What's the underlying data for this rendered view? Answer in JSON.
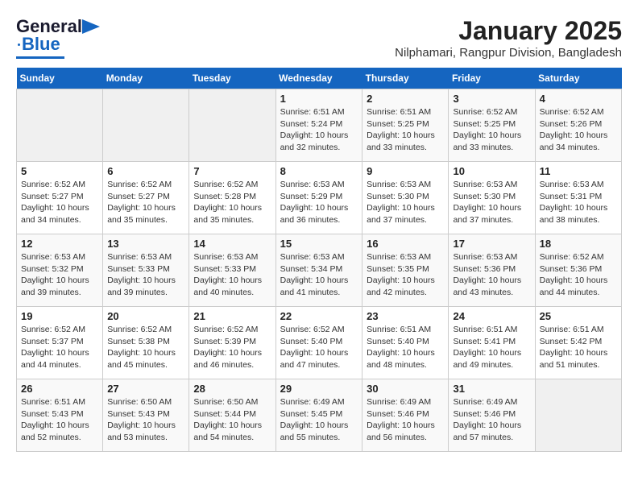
{
  "header": {
    "logo_general": "General",
    "logo_blue": "Blue",
    "title": "January 2025",
    "subtitle": "Nilphamari, Rangpur Division, Bangladesh"
  },
  "weekdays": [
    "Sunday",
    "Monday",
    "Tuesday",
    "Wednesday",
    "Thursday",
    "Friday",
    "Saturday"
  ],
  "weeks": [
    [
      {
        "day": "",
        "text": ""
      },
      {
        "day": "",
        "text": ""
      },
      {
        "day": "",
        "text": ""
      },
      {
        "day": "1",
        "text": "Sunrise: 6:51 AM\nSunset: 5:24 PM\nDaylight: 10 hours\nand 32 minutes."
      },
      {
        "day": "2",
        "text": "Sunrise: 6:51 AM\nSunset: 5:25 PM\nDaylight: 10 hours\nand 33 minutes."
      },
      {
        "day": "3",
        "text": "Sunrise: 6:52 AM\nSunset: 5:25 PM\nDaylight: 10 hours\nand 33 minutes."
      },
      {
        "day": "4",
        "text": "Sunrise: 6:52 AM\nSunset: 5:26 PM\nDaylight: 10 hours\nand 34 minutes."
      }
    ],
    [
      {
        "day": "5",
        "text": "Sunrise: 6:52 AM\nSunset: 5:27 PM\nDaylight: 10 hours\nand 34 minutes."
      },
      {
        "day": "6",
        "text": "Sunrise: 6:52 AM\nSunset: 5:27 PM\nDaylight: 10 hours\nand 35 minutes."
      },
      {
        "day": "7",
        "text": "Sunrise: 6:52 AM\nSunset: 5:28 PM\nDaylight: 10 hours\nand 35 minutes."
      },
      {
        "day": "8",
        "text": "Sunrise: 6:53 AM\nSunset: 5:29 PM\nDaylight: 10 hours\nand 36 minutes."
      },
      {
        "day": "9",
        "text": "Sunrise: 6:53 AM\nSunset: 5:30 PM\nDaylight: 10 hours\nand 37 minutes."
      },
      {
        "day": "10",
        "text": "Sunrise: 6:53 AM\nSunset: 5:30 PM\nDaylight: 10 hours\nand 37 minutes."
      },
      {
        "day": "11",
        "text": "Sunrise: 6:53 AM\nSunset: 5:31 PM\nDaylight: 10 hours\nand 38 minutes."
      }
    ],
    [
      {
        "day": "12",
        "text": "Sunrise: 6:53 AM\nSunset: 5:32 PM\nDaylight: 10 hours\nand 39 minutes."
      },
      {
        "day": "13",
        "text": "Sunrise: 6:53 AM\nSunset: 5:33 PM\nDaylight: 10 hours\nand 39 minutes."
      },
      {
        "day": "14",
        "text": "Sunrise: 6:53 AM\nSunset: 5:33 PM\nDaylight: 10 hours\nand 40 minutes."
      },
      {
        "day": "15",
        "text": "Sunrise: 6:53 AM\nSunset: 5:34 PM\nDaylight: 10 hours\nand 41 minutes."
      },
      {
        "day": "16",
        "text": "Sunrise: 6:53 AM\nSunset: 5:35 PM\nDaylight: 10 hours\nand 42 minutes."
      },
      {
        "day": "17",
        "text": "Sunrise: 6:53 AM\nSunset: 5:36 PM\nDaylight: 10 hours\nand 43 minutes."
      },
      {
        "day": "18",
        "text": "Sunrise: 6:52 AM\nSunset: 5:36 PM\nDaylight: 10 hours\nand 44 minutes."
      }
    ],
    [
      {
        "day": "19",
        "text": "Sunrise: 6:52 AM\nSunset: 5:37 PM\nDaylight: 10 hours\nand 44 minutes."
      },
      {
        "day": "20",
        "text": "Sunrise: 6:52 AM\nSunset: 5:38 PM\nDaylight: 10 hours\nand 45 minutes."
      },
      {
        "day": "21",
        "text": "Sunrise: 6:52 AM\nSunset: 5:39 PM\nDaylight: 10 hours\nand 46 minutes."
      },
      {
        "day": "22",
        "text": "Sunrise: 6:52 AM\nSunset: 5:40 PM\nDaylight: 10 hours\nand 47 minutes."
      },
      {
        "day": "23",
        "text": "Sunrise: 6:51 AM\nSunset: 5:40 PM\nDaylight: 10 hours\nand 48 minutes."
      },
      {
        "day": "24",
        "text": "Sunrise: 6:51 AM\nSunset: 5:41 PM\nDaylight: 10 hours\nand 49 minutes."
      },
      {
        "day": "25",
        "text": "Sunrise: 6:51 AM\nSunset: 5:42 PM\nDaylight: 10 hours\nand 51 minutes."
      }
    ],
    [
      {
        "day": "26",
        "text": "Sunrise: 6:51 AM\nSunset: 5:43 PM\nDaylight: 10 hours\nand 52 minutes."
      },
      {
        "day": "27",
        "text": "Sunrise: 6:50 AM\nSunset: 5:43 PM\nDaylight: 10 hours\nand 53 minutes."
      },
      {
        "day": "28",
        "text": "Sunrise: 6:50 AM\nSunset: 5:44 PM\nDaylight: 10 hours\nand 54 minutes."
      },
      {
        "day": "29",
        "text": "Sunrise: 6:49 AM\nSunset: 5:45 PM\nDaylight: 10 hours\nand 55 minutes."
      },
      {
        "day": "30",
        "text": "Sunrise: 6:49 AM\nSunset: 5:46 PM\nDaylight: 10 hours\nand 56 minutes."
      },
      {
        "day": "31",
        "text": "Sunrise: 6:49 AM\nSunset: 5:46 PM\nDaylight: 10 hours\nand 57 minutes."
      },
      {
        "day": "",
        "text": ""
      }
    ]
  ]
}
